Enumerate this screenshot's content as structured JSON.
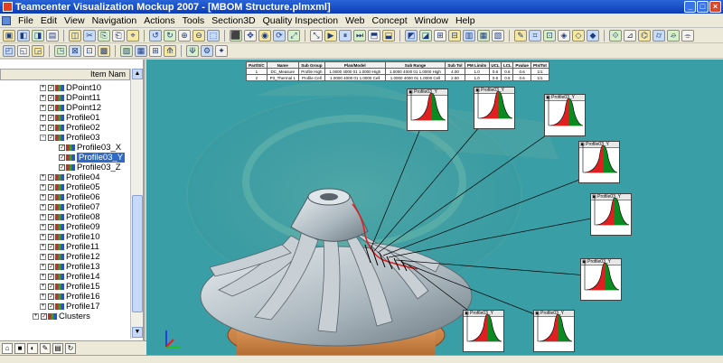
{
  "window": {
    "title": "Teamcenter Visualization Mockup 2007 - [MBOM Structure.plmxml]"
  },
  "menu": [
    "File",
    "Edit",
    "View",
    "Navigation",
    "Actions",
    "Tools",
    "Section3D",
    "Quality Inspection",
    "Web",
    "Concept",
    "Window",
    "Help"
  ],
  "tree": {
    "header": "Item Nam",
    "rows": [
      {
        "label": "DPoint10",
        "indent": 44,
        "expander": "+"
      },
      {
        "label": "DPoint11",
        "indent": 44,
        "expander": "+"
      },
      {
        "label": "DPoint12",
        "indent": 44,
        "expander": "+"
      },
      {
        "label": "Profile01",
        "indent": 44,
        "expander": "+"
      },
      {
        "label": "Profile02",
        "indent": 44,
        "expander": "+"
      },
      {
        "label": "Profile03",
        "indent": 44,
        "expander": "−"
      },
      {
        "label": "Profile03_X",
        "indent": 56,
        "expander": ""
      },
      {
        "label": "Profile03_Y",
        "indent": 56,
        "expander": "",
        "selected": true
      },
      {
        "label": "Profile03_Z",
        "indent": 56,
        "expander": ""
      },
      {
        "label": "Profile04",
        "indent": 44,
        "expander": "+"
      },
      {
        "label": "Profile05",
        "indent": 44,
        "expander": "+"
      },
      {
        "label": "Profile06",
        "indent": 44,
        "expander": "+"
      },
      {
        "label": "Profile07",
        "indent": 44,
        "expander": "+"
      },
      {
        "label": "Profile08",
        "indent": 44,
        "expander": "+"
      },
      {
        "label": "Profile09",
        "indent": 44,
        "expander": "+"
      },
      {
        "label": "Profile10",
        "indent": 44,
        "expander": "+"
      },
      {
        "label": "Profile11",
        "indent": 44,
        "expander": "+"
      },
      {
        "label": "Profile12",
        "indent": 44,
        "expander": "+"
      },
      {
        "label": "Profile13",
        "indent": 44,
        "expander": "+"
      },
      {
        "label": "Profile14",
        "indent": 44,
        "expander": "+"
      },
      {
        "label": "Profile15",
        "indent": 44,
        "expander": "+"
      },
      {
        "label": "Profile16",
        "indent": 44,
        "expander": "+"
      },
      {
        "label": "Profile17",
        "indent": 44,
        "expander": "+"
      },
      {
        "label": "Clusters",
        "indent": 36,
        "expander": "+"
      }
    ]
  },
  "table": {
    "headers": [
      "Part/S/C",
      "Name",
      "Sub Group",
      "Plan/Model",
      "Sub Range",
      "Sub Tol",
      "PM Limits",
      "UCL",
      "LCL",
      "Pvalue",
      "Pts/Tot"
    ],
    "rows": [
      [
        "1",
        "DC_Measure",
        "Profile High",
        "1.0000 4000 01 1.0000 High",
        "1.0000 4000 01 1.0000 High",
        "4.00",
        "1.0",
        "0.6",
        "0.6",
        "0.6",
        "1/1"
      ],
      [
        "2",
        "P3_Thermal 1",
        "Profile Cell",
        "1.0000 4000 01 1.0000 Cell",
        "1.0000 4000 01 1.0000 Cell",
        "2.50",
        "1.0",
        "0.6",
        "0.6",
        "0.6",
        "1/1"
      ]
    ]
  },
  "profiles": [
    {
      "title": "Profile03_Y"
    },
    {
      "title": "Profile03_Y"
    },
    {
      "title": "Profile03_Y"
    },
    {
      "title": "Profile03_Y"
    },
    {
      "title": "Profile03_Y"
    },
    {
      "title": "Profile03_Y"
    },
    {
      "title": "Profile03_Y"
    },
    {
      "title": "Profile03_Y"
    }
  ],
  "colors": {
    "viewport_bg": "#3a9ea6",
    "selection": "#316ac5",
    "dist_red": "#e02020",
    "dist_green": "#0a8a20"
  }
}
